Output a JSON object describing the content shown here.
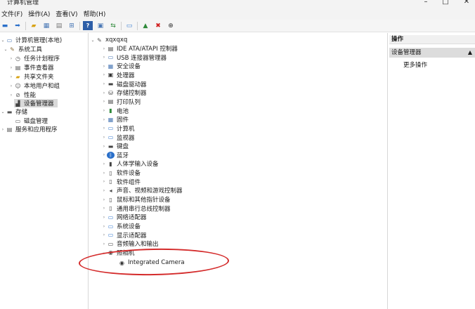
{
  "window": {
    "title": "计算机管理"
  },
  "menu": [
    "文件(F)",
    "操作(A)",
    "查看(V)",
    "帮助(H)"
  ],
  "toolbar_icons": [
    "back-icon",
    "forward-icon",
    "up-folder-icon",
    "console-tree-icon",
    "properties-icon",
    "export-icon",
    "help-icon",
    "view-icon",
    "refresh-icon",
    "monitor-icon",
    "enable-icon",
    "uninstall-icon",
    "update-driver-icon"
  ],
  "left_tree": [
    {
      "label": "计算机管理(本地)",
      "icon": "computer-icon"
    },
    {
      "label": "系统工具",
      "icon": "tools-icon"
    },
    {
      "label": "任务计划程序",
      "icon": "clock-icon"
    },
    {
      "label": "事件查看器",
      "icon": "event-icon"
    },
    {
      "label": "共享文件夹",
      "icon": "folder-icon"
    },
    {
      "label": "本地用户和组",
      "icon": "users-icon"
    },
    {
      "label": "性能",
      "icon": "performance-icon"
    },
    {
      "label": "设备管理器",
      "icon": "device-manager-icon"
    },
    {
      "label": "存储",
      "icon": "storage-icon"
    },
    {
      "label": "磁盘管理",
      "icon": "disk-icon"
    },
    {
      "label": "服务和应用程序",
      "icon": "services-icon"
    }
  ],
  "device_tree": {
    "root": "xqxqxq",
    "categories": [
      {
        "label": "IDE ATA/ATAPI 控制器",
        "icon": "ide-icon"
      },
      {
        "label": "USB 连接器管理器",
        "icon": "usb-icon"
      },
      {
        "label": "安全设备",
        "icon": "security-icon"
      },
      {
        "label": "处理器",
        "icon": "cpu-icon"
      },
      {
        "label": "磁盘驱动器",
        "icon": "disk-drive-icon"
      },
      {
        "label": "存储控制器",
        "icon": "storage-controller-icon"
      },
      {
        "label": "打印队列",
        "icon": "printer-icon"
      },
      {
        "label": "电池",
        "icon": "battery-icon"
      },
      {
        "label": "固件",
        "icon": "firmware-icon"
      },
      {
        "label": "计算机",
        "icon": "computer-icon"
      },
      {
        "label": "监视器",
        "icon": "monitor-icon"
      },
      {
        "label": "键盘",
        "icon": "keyboard-icon"
      },
      {
        "label": "蓝牙",
        "icon": "bluetooth-icon"
      },
      {
        "label": "人体学输入设备",
        "icon": "hid-icon"
      },
      {
        "label": "软件设备",
        "icon": "software-device-icon"
      },
      {
        "label": "软件组件",
        "icon": "software-component-icon"
      },
      {
        "label": "声音、视频和游戏控制器",
        "icon": "sound-icon"
      },
      {
        "label": "鼠标和其他指针设备",
        "icon": "mouse-icon"
      },
      {
        "label": "通用串行总线控制器",
        "icon": "usb-controller-icon"
      },
      {
        "label": "网络适配器",
        "icon": "network-icon"
      },
      {
        "label": "系统设备",
        "icon": "system-device-icon"
      },
      {
        "label": "显示适配器",
        "icon": "display-adapter-icon"
      },
      {
        "label": "音频输入和输出",
        "icon": "audio-io-icon"
      },
      {
        "label": "照相机",
        "icon": "camera-icon"
      }
    ],
    "camera_child": "Integrated Camera"
  },
  "actions": {
    "header": "操作",
    "section": "设备管理器",
    "more": "更多操作"
  },
  "colors": {
    "highlight_circle": "#d42b2b",
    "selection": "#d9d9d9",
    "window_bg": "#f3f3f3"
  }
}
